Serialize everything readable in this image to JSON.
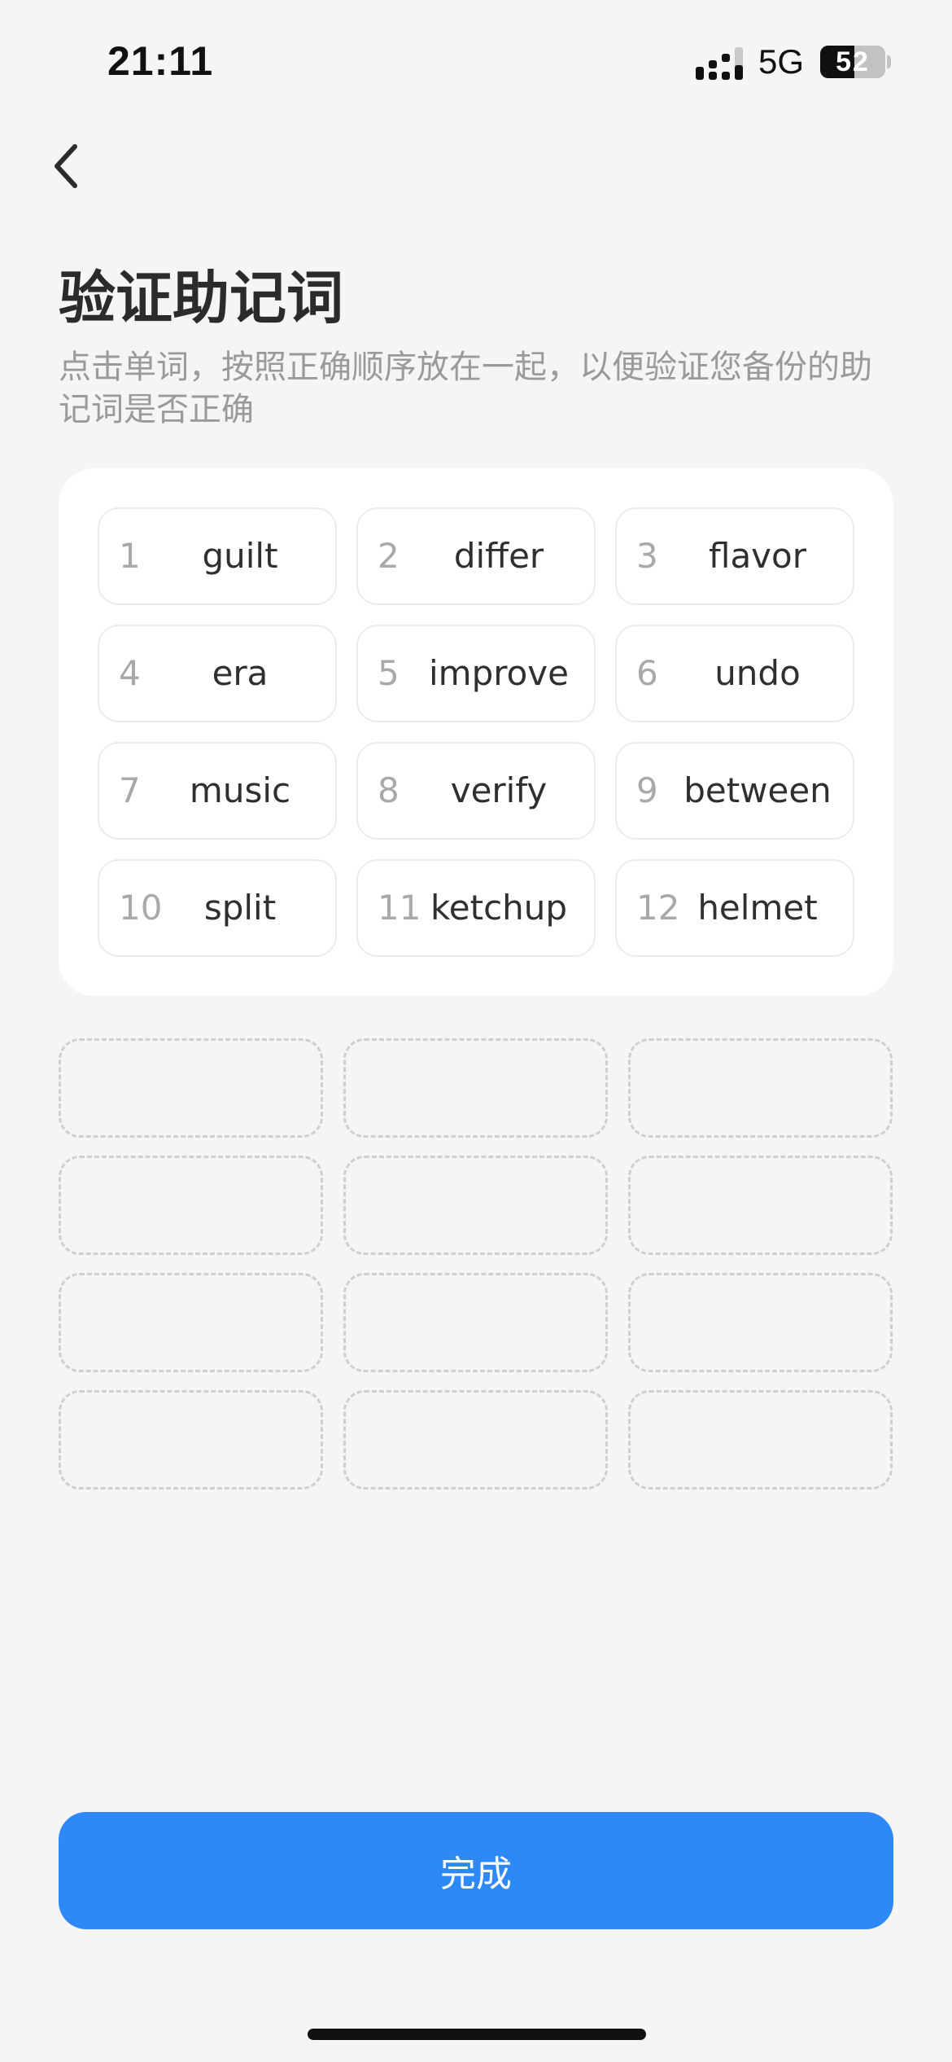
{
  "status_bar": {
    "time": "21:11",
    "network": "5G",
    "battery_text": "52",
    "battery_level": 0.52
  },
  "header": {
    "back_icon": "chevron-left-icon"
  },
  "title": "验证助记词",
  "instruction": "点击单词，按照正确顺序放在一起，以便验证您备份的助记词是否正确",
  "words": [
    {
      "num": "1",
      "word": "guilt"
    },
    {
      "num": "2",
      "word": "differ"
    },
    {
      "num": "3",
      "word": "flavor"
    },
    {
      "num": "4",
      "word": "era"
    },
    {
      "num": "5",
      "word": "improve"
    },
    {
      "num": "6",
      "word": "undo"
    },
    {
      "num": "7",
      "word": "music"
    },
    {
      "num": "8",
      "word": "verify"
    },
    {
      "num": "9",
      "word": "between"
    },
    {
      "num": "10",
      "word": "split"
    },
    {
      "num": "11",
      "word": "ketchup"
    },
    {
      "num": "12",
      "word": "helmet"
    }
  ],
  "slot_count": 12,
  "done_label": "完成",
  "colors": {
    "background": "#f5f5f5",
    "primary": "#2d89f8",
    "title": "#2b2b2b",
    "muted": "#9a9a9a"
  }
}
